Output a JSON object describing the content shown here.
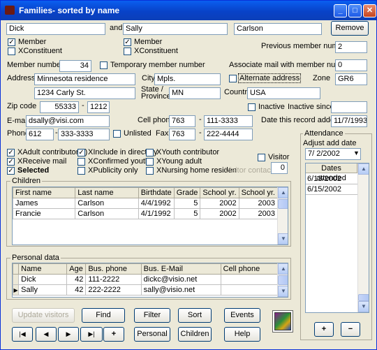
{
  "window": {
    "title": "Families- sorted by name"
  },
  "names": {
    "first1": "Dick",
    "and_label": "and",
    "first2": "Sally",
    "last": "Carlson",
    "remove": "Remove"
  },
  "member": {
    "member1": "Member",
    "xconst1": "XConstituent",
    "member2": "Member",
    "xconst2": "XConstituent",
    "prev_label": "Previous member number",
    "prev_value": "2"
  },
  "numbers": {
    "member_label": "Member number",
    "member_value": "34",
    "temp_label": "Temporary member number",
    "assoc_label": "Associate mail with member number",
    "assoc_value": "0"
  },
  "address": {
    "label": "Address",
    "line1": "Minnesota residence",
    "line2": "1234 Carly St.",
    "city_label": "City",
    "city": "Mpls.",
    "alt_label": "Alternate address",
    "zone_label": "Zone",
    "zone": "GR6",
    "state_label": "State /",
    "province_label": "Province",
    "state": "MN",
    "country_label": "Country",
    "country": "USA",
    "zip_label": "Zip code",
    "zip": "55333",
    "zip_dash": "-",
    "zip4": "1212",
    "inactive_label": "Inactive",
    "inactive_since_label": "Inactive since",
    "inactive_since": ""
  },
  "contact": {
    "email_label": "E-mail",
    "email": "dsally@visi.com",
    "cell_label": "Cell phone",
    "cell_area": "763",
    "cell_num": "111-3333",
    "added_label": "Date this record added",
    "added": "11/7/1993",
    "phone_label": "Phone",
    "phone_area": "612",
    "phone_num": "333-3333",
    "unlisted_label": "Unlisted",
    "fax_label": "Fax",
    "fax_area": "763",
    "fax_num": "222-4444",
    "dash": "-"
  },
  "flags": {
    "col1": [
      {
        "label": "XAdult contributor(s)",
        "checked": true
      },
      {
        "label": "XReceive mail",
        "checked": true
      },
      {
        "label": "Selected",
        "checked": true
      }
    ],
    "col2": [
      {
        "label": "XInclude in directory",
        "checked": true
      },
      {
        "label": "XConfirmed youth",
        "checked": false
      },
      {
        "label": "XPublicity only",
        "checked": false
      }
    ],
    "col3": [
      {
        "label": "XYouth contributor",
        "checked": false
      },
      {
        "label": "XYoung adult",
        "checked": false
      },
      {
        "label": "XNursing home residen",
        "checked": false
      }
    ],
    "visitor_label": "Visitor",
    "visitor_contacts_label": "Visitor contacts",
    "visitor_contacts": "0"
  },
  "children": {
    "legend": "Children",
    "headers": [
      "First name",
      "Last name",
      "Birthdate",
      "Grade",
      "School yr.",
      "School yr."
    ],
    "rows": [
      [
        "James",
        "Carlson",
        "4/4/1992",
        "5",
        "2002",
        "2003"
      ],
      [
        "Francie",
        "Carlson",
        "4/1/1992",
        "5",
        "2002",
        "2003"
      ]
    ]
  },
  "personal": {
    "legend": "Personal data",
    "headers": [
      "Name",
      "Age",
      "Bus. phone",
      "Bus. E-Mail",
      "Cell phone"
    ],
    "rows": [
      [
        "Dick",
        "42",
        "111-2222",
        "dickc@visio.net",
        ""
      ],
      [
        "Sally",
        "42",
        "222-2222",
        "sally@visio.net",
        ""
      ]
    ]
  },
  "attendance": {
    "legend": "Attendance",
    "adjust_label": "Adjust add date",
    "adjust_value": "7/ 2/2002",
    "list_header": "Dates attended",
    "dates": [
      "6/13/2002",
      "6/15/2002"
    ],
    "add": "+",
    "remove": "−"
  },
  "buttons": {
    "update_visitors": "Update visitors",
    "find": "Find",
    "filter": "Filter",
    "sort": "Sort",
    "events": "Events",
    "personal": "Personal",
    "children": "Children",
    "help": "Help",
    "first": "|◀",
    "prev": "◀",
    "next": "▶",
    "last": "▶|",
    "add": "+"
  }
}
